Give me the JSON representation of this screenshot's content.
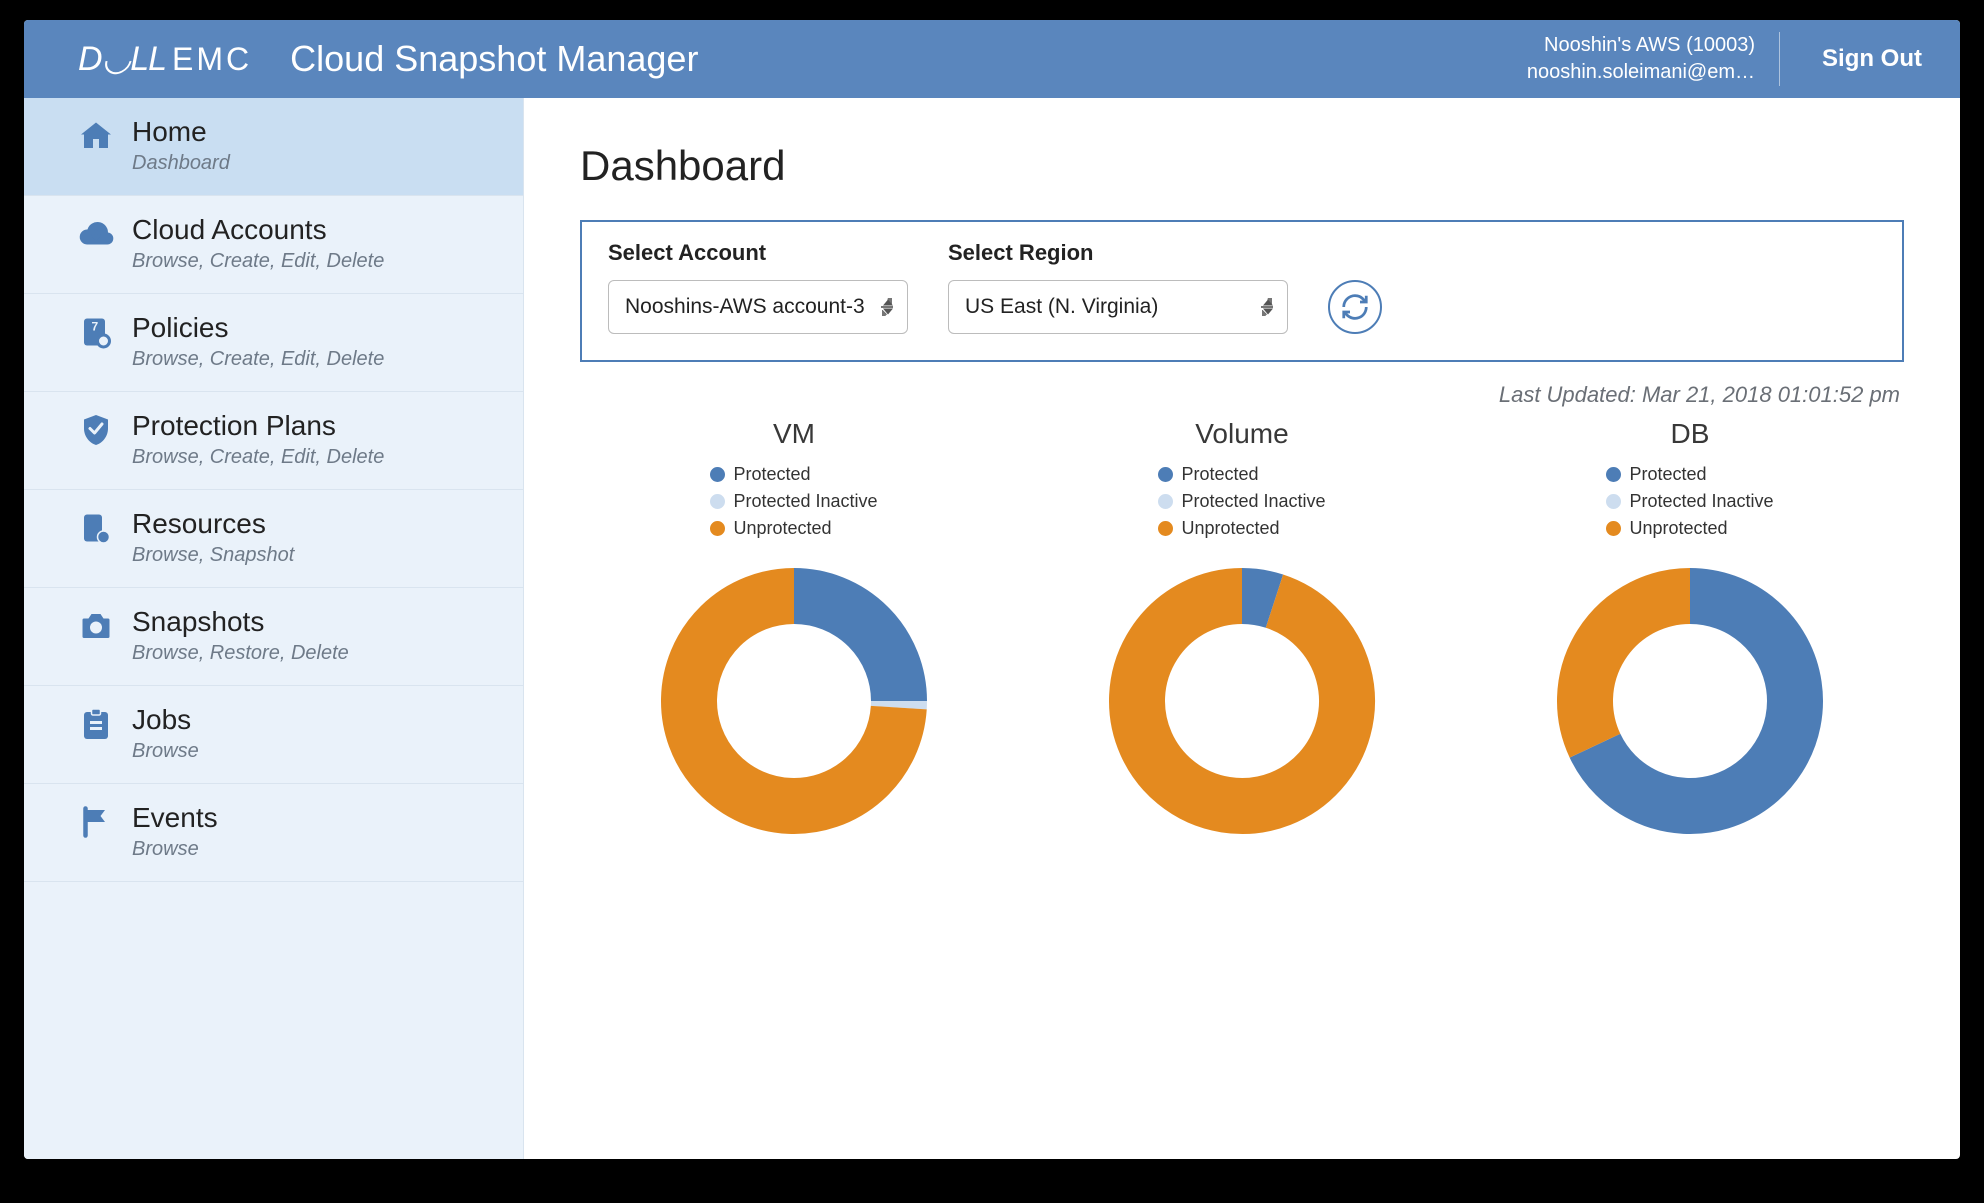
{
  "header": {
    "brand_dell": "D◡LL",
    "brand_emc": "EMC",
    "app_title": "Cloud Snapshot Manager",
    "account_line1": "Nooshin's AWS (10003)",
    "account_line2": "nooshin.soleimani@em…",
    "sign_out": "Sign Out"
  },
  "sidebar": {
    "items": [
      {
        "icon": "home",
        "title": "Home",
        "sub": "Dashboard",
        "active": true
      },
      {
        "icon": "cloud",
        "title": "Cloud Accounts",
        "sub": "Browse, Create, Edit, Delete",
        "active": false
      },
      {
        "icon": "policy",
        "title": "Policies",
        "sub": "Browse, Create, Edit, Delete",
        "active": false
      },
      {
        "icon": "shield",
        "title": "Protection Plans",
        "sub": "Browse, Create, Edit, Delete",
        "active": false
      },
      {
        "icon": "resource",
        "title": "Resources",
        "sub": "Browse, Snapshot",
        "active": false
      },
      {
        "icon": "camera",
        "title": "Snapshots",
        "sub": "Browse, Restore, Delete",
        "active": false
      },
      {
        "icon": "jobs",
        "title": "Jobs",
        "sub": "Browse",
        "active": false
      },
      {
        "icon": "flag",
        "title": "Events",
        "sub": "Browse",
        "active": false
      }
    ]
  },
  "main": {
    "title": "Dashboard",
    "filters": {
      "account_label": "Select Account",
      "account_value": "Nooshins-AWS account-3",
      "region_label": "Select Region",
      "region_value": "US East (N. Virginia)"
    },
    "last_updated": "Last Updated: Mar 21, 2018 01:01:52 pm",
    "legend_labels": [
      "Protected",
      "Protected Inactive",
      "Unprotected"
    ],
    "colors": {
      "protected": "#4d7db6",
      "protected_inactive": "#cdddef",
      "unprotected": "#e48a1f"
    }
  },
  "chart_data": [
    {
      "type": "pie",
      "title": "VM",
      "series": [
        {
          "name": "Protected",
          "value": 25,
          "color": "#4d7db6"
        },
        {
          "name": "Protected Inactive",
          "value": 1,
          "color": "#cdddef"
        },
        {
          "name": "Unprotected",
          "value": 74,
          "color": "#e48a1f"
        }
      ]
    },
    {
      "type": "pie",
      "title": "Volume",
      "series": [
        {
          "name": "Protected",
          "value": 5,
          "color": "#4d7db6"
        },
        {
          "name": "Protected Inactive",
          "value": 0,
          "color": "#cdddef"
        },
        {
          "name": "Unprotected",
          "value": 95,
          "color": "#e48a1f"
        }
      ]
    },
    {
      "type": "pie",
      "title": "DB",
      "series": [
        {
          "name": "Protected",
          "value": 68,
          "color": "#4d7db6"
        },
        {
          "name": "Protected Inactive",
          "value": 0,
          "color": "#cdddef"
        },
        {
          "name": "Unprotected",
          "value": 32,
          "color": "#e48a1f"
        }
      ]
    }
  ]
}
